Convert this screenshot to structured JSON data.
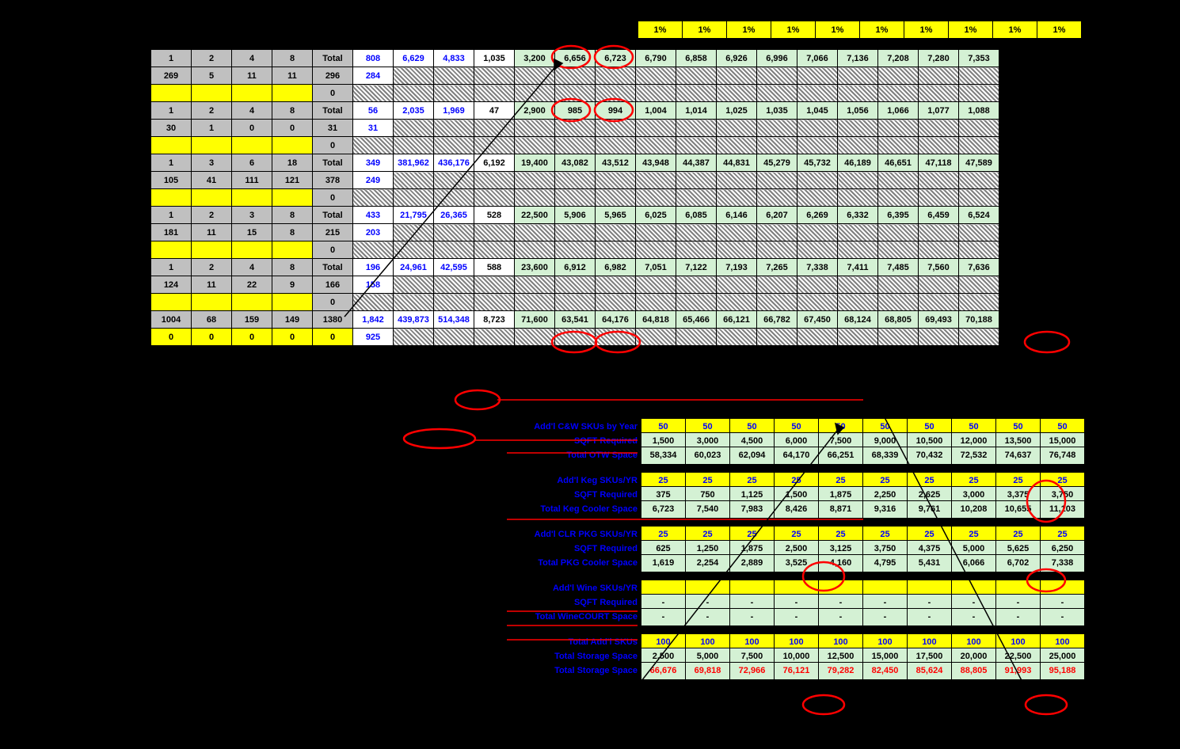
{
  "pct": [
    "1%",
    "1%",
    "1%",
    "1%",
    "1%",
    "1%",
    "1%",
    "1%",
    "1%",
    "1%"
  ],
  "rows": [
    {
      "g": [
        "1",
        "2",
        "4",
        "8",
        "Total"
      ],
      "b": [
        "808",
        "6,629",
        "4,833"
      ],
      "w": "1,035",
      "gr": [
        "3,200",
        "6,656",
        "6,723",
        "6,790",
        "6,858",
        "6,926",
        "6,996",
        "7,066",
        "7,136",
        "7,208",
        "7,280",
        "7,353"
      ]
    },
    {
      "g": [
        "269",
        "5",
        "11",
        "11",
        "296"
      ],
      "b": [
        "284"
      ],
      "htch": true
    },
    {
      "ylw": true,
      "g": [
        "",
        "",
        "",
        ""
      ],
      "t": "0",
      "htch": true
    },
    {
      "g": [
        "1",
        "2",
        "4",
        "8",
        "Total"
      ],
      "b": [
        "56",
        "2,035",
        "1,969"
      ],
      "w": "47",
      "gr": [
        "2,900",
        "985",
        "994",
        "1,004",
        "1,014",
        "1,025",
        "1,035",
        "1,045",
        "1,056",
        "1,066",
        "1,077",
        "1,088"
      ]
    },
    {
      "g": [
        "30",
        "1",
        "0",
        "0",
        "31"
      ],
      "b": [
        "31"
      ],
      "htch": true
    },
    {
      "ylw": true,
      "g": [
        "",
        "",
        "",
        ""
      ],
      "t": "0",
      "htch": true
    },
    {
      "g": [
        "1",
        "3",
        "6",
        "18",
        "Total"
      ],
      "b": [
        "349",
        "381,962",
        "436,176"
      ],
      "w": "6,192",
      "gr": [
        "19,400",
        "43,082",
        "43,512",
        "43,948",
        "44,387",
        "44,831",
        "45,279",
        "45,732",
        "46,189",
        "46,651",
        "47,118",
        "47,589"
      ]
    },
    {
      "g": [
        "105",
        "41",
        "111",
        "121",
        "378"
      ],
      "b": [
        "249"
      ],
      "htch": true
    },
    {
      "ylw": true,
      "g": [
        "",
        "",
        "",
        ""
      ],
      "t": "0",
      "htch": true
    },
    {
      "g": [
        "1",
        "2",
        "3",
        "8",
        "Total"
      ],
      "b": [
        "433",
        "21,795",
        "26,365"
      ],
      "w": "528",
      "gr": [
        "22,500",
        "5,906",
        "5,965",
        "6,025",
        "6,085",
        "6,146",
        "6,207",
        "6,269",
        "6,332",
        "6,395",
        "6,459",
        "6,524"
      ]
    },
    {
      "g": [
        "181",
        "11",
        "15",
        "8",
        "215"
      ],
      "b": [
        "203"
      ],
      "htch": true
    },
    {
      "ylw": true,
      "g": [
        "",
        "",
        "",
        ""
      ],
      "t": "0",
      "htch": true
    },
    {
      "g": [
        "1",
        "2",
        "4",
        "8",
        "Total"
      ],
      "b": [
        "196",
        "24,961",
        "42,595"
      ],
      "w": "588",
      "gr": [
        "23,600",
        "6,912",
        "6,982",
        "7,051",
        "7,122",
        "7,193",
        "7,265",
        "7,338",
        "7,411",
        "7,485",
        "7,560",
        "7,636"
      ]
    },
    {
      "g": [
        "124",
        "11",
        "22",
        "9",
        "166"
      ],
      "b": [
        "158"
      ],
      "htch": true
    },
    {
      "ylw": true,
      "g": [
        "",
        "",
        "",
        ""
      ],
      "t": "0",
      "htch": true
    },
    {
      "g": [
        "1004",
        "68",
        "159",
        "149",
        "1380"
      ],
      "b": [
        "1,842",
        "439,873",
        "514,348"
      ],
      "w": "8,723",
      "gr": [
        "71,600",
        "63,541",
        "64,176",
        "64,818",
        "65,466",
        "66,121",
        "66,782",
        "67,450",
        "68,124",
        "68,805",
        "69,493",
        "70,188"
      ]
    },
    {
      "g": [
        "0",
        "0",
        "0",
        "0",
        "0"
      ],
      "b": [
        "925"
      ],
      "htch": true,
      "ylw0": true
    }
  ],
  "sec": [
    {
      "lbl": "Add'l C&W SKUs by Year",
      "y": [
        "50",
        "50",
        "50",
        "50",
        "50",
        "50",
        "50",
        "50",
        "50",
        "50"
      ]
    },
    {
      "lbl": "SQFT Required",
      "g": [
        "1,500",
        "3,000",
        "4,500",
        "6,000",
        "7,500",
        "9,000",
        "10,500",
        "12,000",
        "13,500",
        "15,000"
      ]
    },
    {
      "lbl": "Total OTW Space",
      "g": [
        "58,334",
        "60,023",
        "62,094",
        "64,170",
        "66,251",
        "68,339",
        "70,432",
        "72,532",
        "74,637",
        "76,748"
      ]
    },
    {
      "br": true
    },
    {
      "lbl": "Add'l Keg SKUs/YR",
      "y": [
        "25",
        "25",
        "25",
        "25",
        "25",
        "25",
        "25",
        "25",
        "25",
        "25"
      ]
    },
    {
      "lbl": "SQFT Required",
      "g": [
        "375",
        "750",
        "1,125",
        "1,500",
        "1,875",
        "2,250",
        "2,625",
        "3,000",
        "3,375",
        "3,750"
      ]
    },
    {
      "lbl": "Total Keg Cooler Space",
      "g": [
        "6,723",
        "7,540",
        "7,983",
        "8,426",
        "8,871",
        "9,316",
        "9,761",
        "10,208",
        "10,655",
        "11,103"
      ]
    },
    {
      "br": true
    },
    {
      "lbl": "Add'l CLR PKG SKUs/YR",
      "y": [
        "25",
        "25",
        "25",
        "25",
        "25",
        "25",
        "25",
        "25",
        "25",
        "25"
      ]
    },
    {
      "lbl": "SQFT Required",
      "g": [
        "625",
        "1,250",
        "1,875",
        "2,500",
        "3,125",
        "3,750",
        "4,375",
        "5,000",
        "5,625",
        "6,250"
      ]
    },
    {
      "lbl": "Total PKG Cooler Space",
      "g": [
        "1,619",
        "2,254",
        "2,889",
        "3,525",
        "4,160",
        "4,795",
        "5,431",
        "6,066",
        "6,702",
        "7,338"
      ]
    },
    {
      "br": true
    },
    {
      "lbl": "Add'l Wine SKUs/YR",
      "y": [
        "",
        "",
        "",
        "",
        "",
        "",
        "",
        "",
        "",
        ""
      ]
    },
    {
      "lbl": "SQFT Required",
      "g": [
        "-",
        "-",
        "-",
        "-",
        "-",
        "-",
        "-",
        "-",
        "-",
        "-"
      ]
    },
    {
      "lbl": "Total WineCOURT Space",
      "g": [
        "-",
        "-",
        "-",
        "-",
        "-",
        "-",
        "-",
        "-",
        "-",
        "-"
      ]
    },
    {
      "br": true
    },
    {
      "lbl": "Total Add'l SKUs",
      "y": [
        "100",
        "100",
        "100",
        "100",
        "100",
        "100",
        "100",
        "100",
        "100",
        "100"
      ]
    },
    {
      "lbl": "Total Storage Space",
      "g": [
        "2,500",
        "5,000",
        "7,500",
        "10,000",
        "12,500",
        "15,000",
        "17,500",
        "20,000",
        "22,500",
        "25,000"
      ]
    },
    {
      "lbl": "Total Storage Space",
      "r": [
        "66,676",
        "69,818",
        "72,966",
        "76,121",
        "79,282",
        "82,450",
        "85,624",
        "88,805",
        "91,993",
        "95,188"
      ]
    }
  ]
}
